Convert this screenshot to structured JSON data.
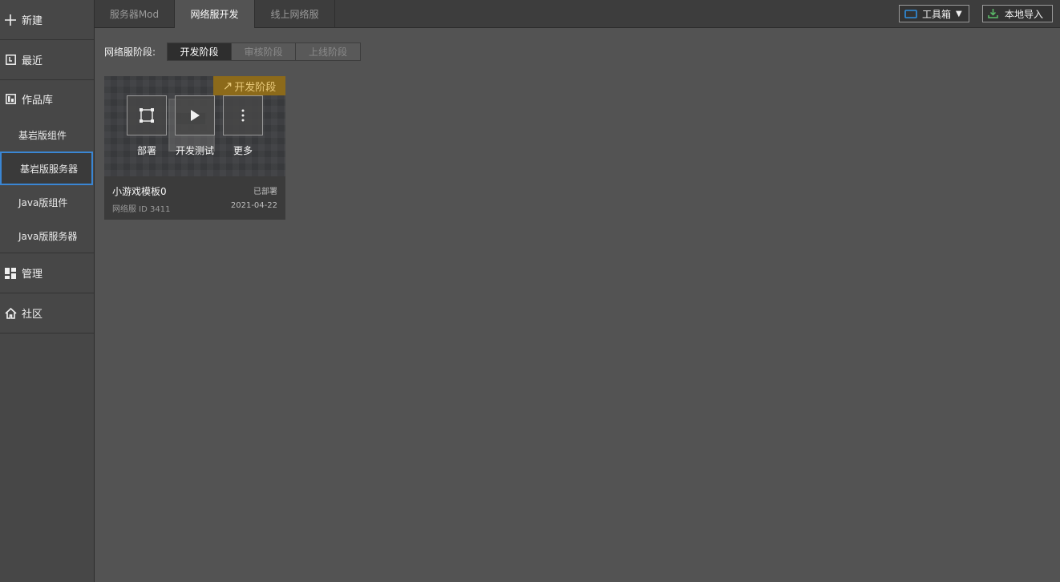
{
  "sidebar": {
    "new_label": "新建",
    "recent_label": "最近",
    "library": {
      "label": "作品库",
      "items": [
        {
          "label": "基岩版组件"
        },
        {
          "label": "基岩版服务器"
        },
        {
          "label": "Java版组件"
        },
        {
          "label": "Java版服务器"
        }
      ]
    },
    "manage_label": "管理",
    "community_label": "社区"
  },
  "tabs": [
    {
      "label": "服务器Mod"
    },
    {
      "label": "网络服开发"
    },
    {
      "label": "线上网络服"
    }
  ],
  "toolbar": {
    "toolbox_label": "工具箱",
    "import_label": "本地导入"
  },
  "stage_filter": {
    "label": "网络服阶段:",
    "options": [
      {
        "label": "开发阶段"
      },
      {
        "label": "审核阶段"
      },
      {
        "label": "上线阶段"
      }
    ],
    "selected": "开发阶段"
  },
  "card": {
    "badge": "开发阶段",
    "actions": {
      "deploy": "部署",
      "test": "开发测试",
      "more": "更多"
    },
    "title": "小游戏模板0",
    "status": "已部署",
    "id_text": "网络服 ID 3411",
    "date": "2021-04-22"
  },
  "colors": {
    "background": "#535353",
    "sidebar": "#474747",
    "accent_blue": "#3a86d4",
    "badge": "#8c6a1a"
  }
}
